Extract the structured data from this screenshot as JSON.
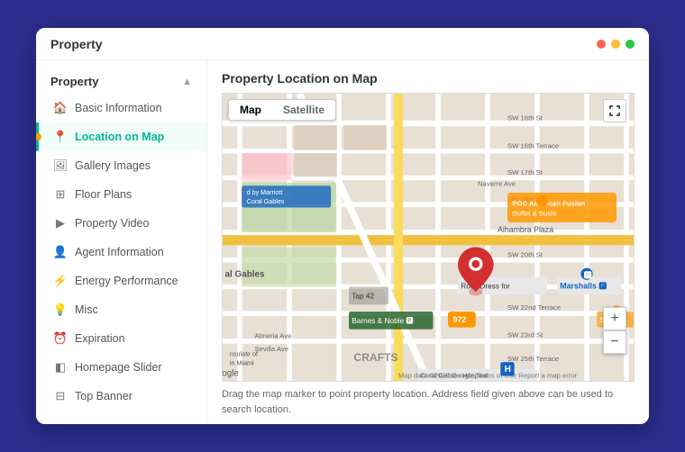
{
  "window": {
    "title": "Property"
  },
  "sidebar": {
    "header": "Property",
    "items": [
      {
        "label": "Basic Information",
        "icon": "🏠",
        "active": false
      },
      {
        "label": "Location on Map",
        "icon": "📍",
        "active": true
      },
      {
        "label": "Gallery Images",
        "icon": "🖼",
        "active": false
      },
      {
        "label": "Floor Plans",
        "icon": "⊞",
        "active": false
      },
      {
        "label": "Property Video",
        "icon": "▶",
        "active": false
      },
      {
        "label": "Agent Information",
        "icon": "👤",
        "active": false
      },
      {
        "label": "Energy Performance",
        "icon": "⚡",
        "active": false
      },
      {
        "label": "Misc",
        "icon": "💡",
        "active": false
      },
      {
        "label": "Expiration",
        "icon": "⏰",
        "active": false
      },
      {
        "label": "Homepage Slider",
        "icon": "◧",
        "active": false
      },
      {
        "label": "Top Banner",
        "icon": "⊟",
        "active": false
      }
    ]
  },
  "main": {
    "title": "Property Location on Map",
    "map": {
      "tab_map": "Map",
      "tab_satellite": "Satellite"
    },
    "footer_text": "Drag the map marker to point property location. Address field given above can be used to search location."
  }
}
